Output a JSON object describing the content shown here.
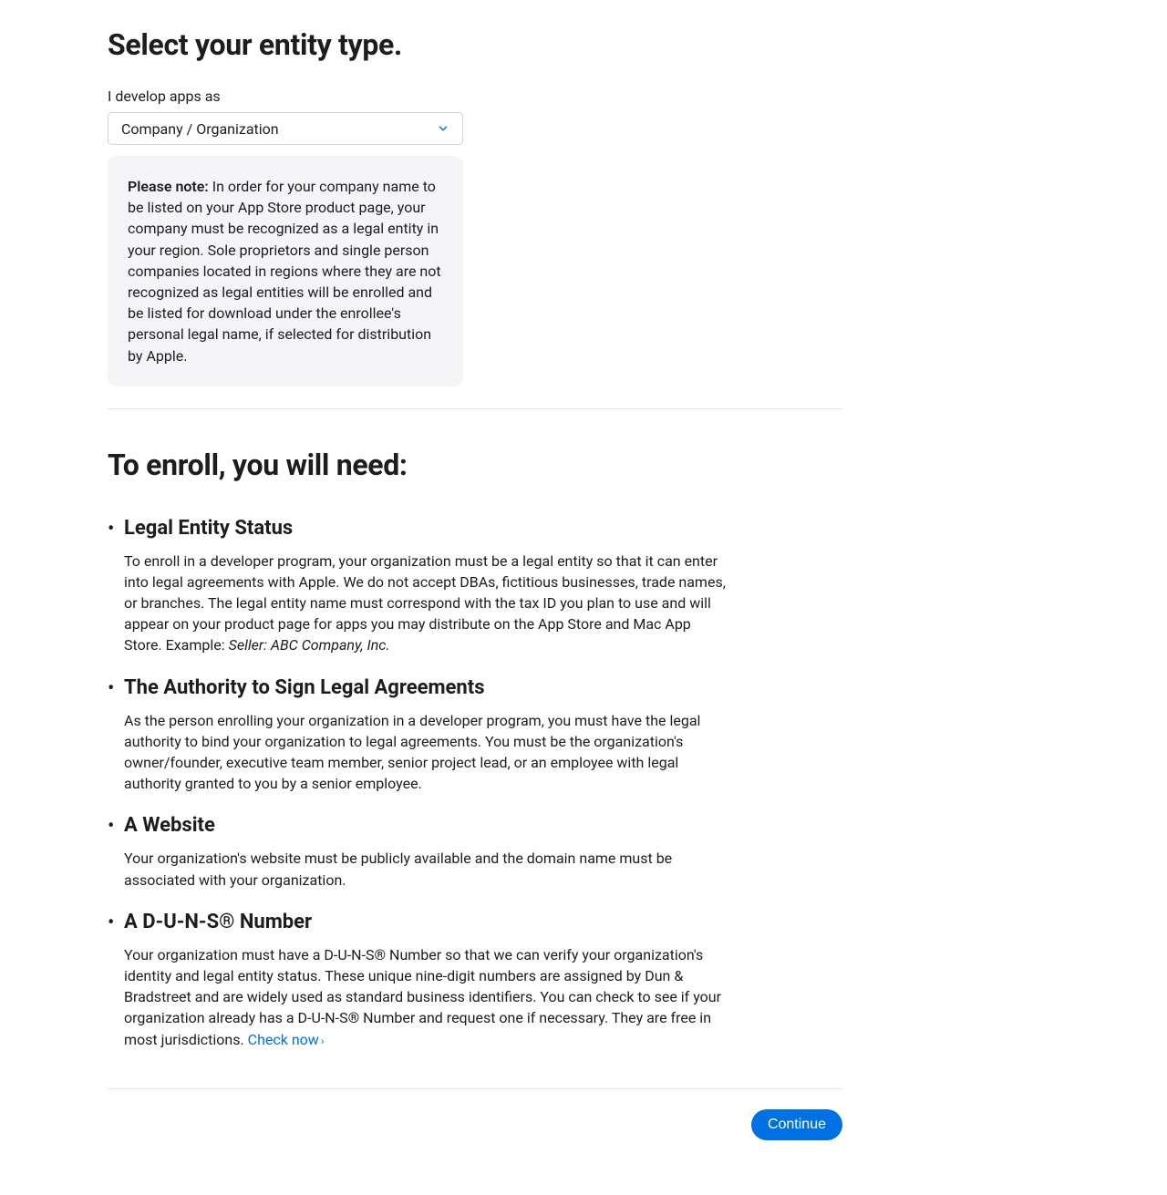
{
  "heading": "Select your entity type.",
  "entity": {
    "label": "I develop apps as",
    "selected": "Company / Organization"
  },
  "note": {
    "prefix": "Please note:",
    "text": " In order for your company name to be listed on your App Store product page, your company must be recognized as a legal entity in your region. Sole proprietors and single person companies located in regions where they are not recognized as legal entities will be enrolled and be listed for download under the enrollee's personal legal name, if selected for distribution by Apple."
  },
  "enroll_heading": "To enroll, you will need:",
  "requirements": {
    "legal_entity": {
      "title": "Legal Entity Status",
      "body": "To enroll in a developer program, your organization must be a legal entity so that it can enter into legal agreements with Apple. We do not accept DBAs, fictitious businesses, trade names, or branches. The legal entity name must correspond with the tax ID you plan to use and will appear on your product page for apps you may distribute on the App Store and Mac App Store. Example: ",
      "example": "Seller: ABC Company, Inc."
    },
    "authority": {
      "title": "The Authority to Sign Legal Agreements",
      "body": "As the person enrolling your organization in a developer program, you must have the legal authority to bind your organization to legal agreements. You must be the organization's owner/founder, executive team member, senior project lead, or an employee with legal authority granted to you by a senior employee."
    },
    "website": {
      "title": "A Website",
      "body": "Your organization's website must be publicly available and the domain name must be associated with your organization."
    },
    "duns": {
      "title": "A D-U-N-S® Number",
      "body": "Your organization must have a D-U-N-S® Number so that we can verify your organization's identity and legal entity status. These unique nine-digit numbers are assigned by Dun & Bradstreet and are widely used as standard business identifiers. You can check to see if your organization already has a D-U-N-S® Number and request one if necessary. They are free in most jurisdictions. ",
      "link_text": "Check now"
    }
  },
  "continue_label": "Continue"
}
